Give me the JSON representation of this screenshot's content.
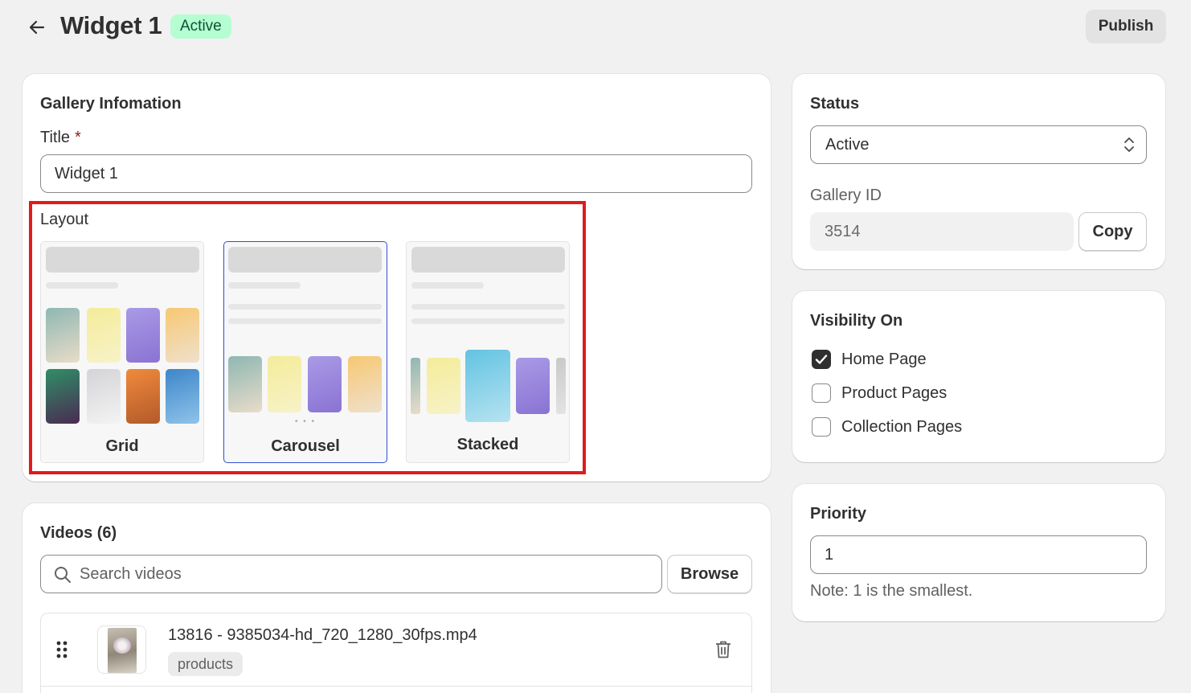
{
  "header": {
    "title": "Widget 1",
    "status_badge": "Active",
    "publish_label": "Publish"
  },
  "gallery_info": {
    "heading": "Gallery Infomation",
    "title_label": "Title",
    "required_mark": "*",
    "title_value": "Widget 1",
    "layout_label": "Layout",
    "layouts": [
      {
        "label": "Grid",
        "selected": false
      },
      {
        "label": "Carousel",
        "selected": true
      },
      {
        "label": "Stacked",
        "selected": false
      }
    ],
    "carousel_pager": "• • •"
  },
  "videos": {
    "heading": "Videos (6)",
    "search_placeholder": "Search videos",
    "browse_label": "Browse",
    "items": [
      {
        "name": "13816 - 9385034-hd_720_1280_30fps.mp4",
        "tag": "products"
      }
    ]
  },
  "status_card": {
    "heading": "Status",
    "selected": "Active",
    "gallery_id_label": "Gallery ID",
    "gallery_id": "3514",
    "copy_label": "Copy"
  },
  "visibility": {
    "heading": "Visibility On",
    "options": [
      {
        "label": "Home Page",
        "checked": true
      },
      {
        "label": "Product Pages",
        "checked": false
      },
      {
        "label": "Collection Pages",
        "checked": false
      }
    ]
  },
  "priority": {
    "heading": "Priority",
    "value": "1",
    "note": "Note: 1 is the smallest."
  },
  "colors": {
    "badge_bg": "#b4fed2",
    "highlight": "#e01b1b",
    "selected_border": "#2c4fd4"
  }
}
